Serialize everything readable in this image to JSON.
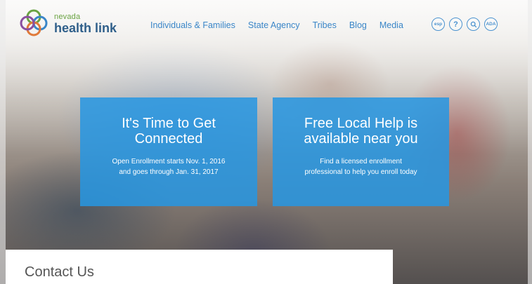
{
  "brand": {
    "small": "nevada",
    "name": "health link",
    "colors": [
      "#6aa342",
      "#2f5f8a",
      "#e07a3a",
      "#8a4fa0",
      "#3a86c8"
    ]
  },
  "nav": {
    "items": [
      "Individuals & Families",
      "State Agency",
      "Tribes",
      "Blog",
      "Media"
    ]
  },
  "tools": [
    {
      "icon": "espanol-icon",
      "label": "esp"
    },
    {
      "icon": "help-icon",
      "label": "?"
    },
    {
      "icon": "search-icon",
      "label": "🔍"
    },
    {
      "icon": "ada-icon",
      "label": "ADA"
    }
  ],
  "cards": [
    {
      "title": "It's Time to Get\nConnected",
      "body": "Open Enrollment starts Nov. 1, 2016\nand goes through Jan. 31, 2017"
    },
    {
      "title": "Free Local Help is\navailable near you",
      "body": "Find a licensed enrollment\nprofessional to help you enroll today"
    }
  ],
  "contact": {
    "title": "Contact Us"
  },
  "accent": "#2696e2"
}
